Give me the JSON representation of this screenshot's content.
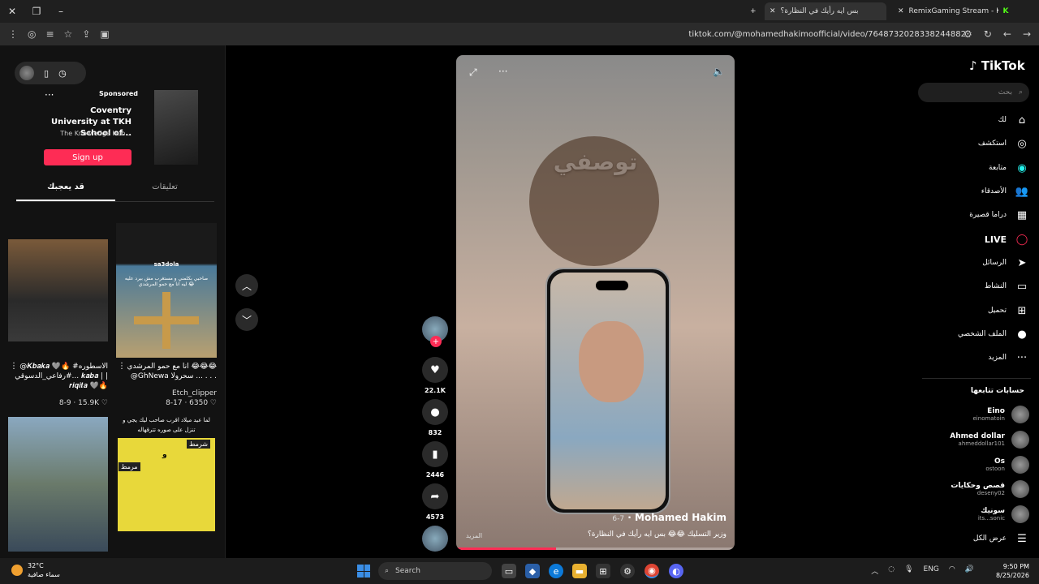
{
  "browser": {
    "tabs": [
      {
        "title": "بس ايه رأيك في النظارة؟"
      },
      {
        "title": "RemixGaming Stream - Kick Da"
      }
    ],
    "url": "tiktok.com/@mohamedhakimoofficial/video/7648732028338244882"
  },
  "ad": {
    "sponsored_label": "Sponsored",
    "title": "Coventry University at TKH School of...",
    "subtitle": "The Knowledge Hub...",
    "cta": "Sign up"
  },
  "left_tabs": {
    "for_you": "قد يعجبك",
    "comments": "تعليقات"
  },
  "suggested": [
    {
      "caption": "@𝑲𝒃𝒂𝒌𝒂 🩶🔥 #الاسطوره #رفاعي_الدسوقي... 𝒌𝒂𝒃𝒂 | | 𝒓𝒊𝒒𝒊𝒕𝒂 🩶🔥",
      "meta": "8-9 · 15.9K ♡"
    },
    {
      "caption": "انا مع حمو المرشدي 😂😂😂 @GhNewa سحرولا ... . . .",
      "author": "Etch_clipper",
      "meta": "8-17 · 6350 ♡"
    },
    {
      "caption": "لما عيد ميلاد اقرب صاحب ليك يجي و تنزل على صوره تترقهاله"
    }
  ],
  "thumb_labels": {
    "t2_top": "sa3dola",
    "t2_mid": "صاحبي بكلمني و مستغرب مش بيرد عليه ليه انا مع حمو المرشدي 😂",
    "t4_a": "شرمط",
    "t4_b": "مرمط",
    "t4_c": "و"
  },
  "video": {
    "overlay_title": "توصفي",
    "author": "Mohamed Hakim",
    "date": "6-7",
    "description": "وزير التسليك 😂😂 بس ايه رأيك في النظارة؟",
    "more_label": "المزيد",
    "progress": 0.36
  },
  "actions": {
    "likes": "22.1K",
    "comments": "832",
    "saves": "2446",
    "shares": "4573"
  },
  "nav": {
    "logo": "TikTok",
    "search_placeholder": "بحث",
    "items": [
      {
        "label": "لك",
        "icon": "home-icon"
      },
      {
        "label": "استكشف",
        "icon": "compass-icon"
      },
      {
        "label": "متابعة",
        "icon": "following-icon"
      },
      {
        "label": "الأصدقاء",
        "icon": "friends-icon"
      },
      {
        "label": "دراما قصيرة",
        "icon": "drama-icon"
      },
      {
        "label": "LIVE",
        "icon": "live-icon"
      },
      {
        "label": "الرسائل",
        "icon": "send-icon"
      },
      {
        "label": "النشاط",
        "icon": "activity-icon"
      },
      {
        "label": "تحميل",
        "icon": "upload-icon"
      },
      {
        "label": "الملف الشخصي",
        "icon": "profile-icon"
      },
      {
        "label": "المزيد",
        "icon": "more-icon"
      }
    ],
    "following_title": "حسابات تتابعها",
    "following": [
      {
        "name": "Eino",
        "handle": "einomatoin"
      },
      {
        "name": "Ahmed dollar",
        "handle": "ahmeddollar101"
      },
      {
        "name": "Os",
        "handle": "ostoon"
      },
      {
        "name": "قصص وحكايات",
        "handle": "deseny02"
      },
      {
        "name": "سونيك",
        "handle": "its...sonic"
      }
    ],
    "show_all": "عرض الكل"
  },
  "taskbar": {
    "temp": "32°C",
    "weather": "سماء صافية",
    "search": "Search",
    "lang": "ENG",
    "time": "9:50 PM",
    "date": "8/25/2026"
  }
}
